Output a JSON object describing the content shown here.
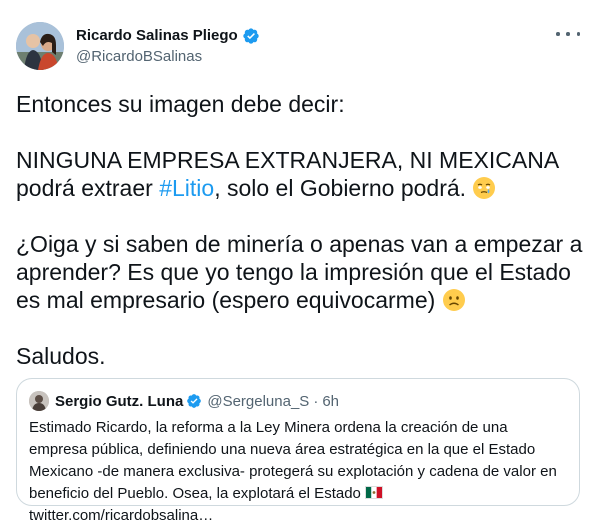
{
  "author": {
    "name": "Ricardo Salinas Pliego",
    "handle": "@RicardoBSalinas"
  },
  "tweet": {
    "p1": "Entonces su imagen debe decir:",
    "p2_part1": "NINGUNA EMPRESA EXTRANJERA, NI MEXICANA podrá extraer ",
    "hashtag": "#Litio",
    "p2_part2": ", solo el Gobierno podrá. ",
    "p3": "¿Oiga y si saben de minería o apenas van a empezar a aprender? Es que yo tengo la impresión que el Estado es mal empresario (espero equivocarme) ",
    "p4": "Saludos."
  },
  "quote": {
    "name": "Sergio Gutz. Luna",
    "handle": "@Sergeluna_S",
    "separator": "·",
    "time": "6h",
    "text_part1": "Estimado Ricardo, la reforma a la Ley Minera ordena la creación de una empresa pública, definiendo una nueva área estratégica en la que el Estado Mexicano -de manera exclusiva- protegerá su explotación y cadena de valor en beneficio del Pueblo. Osea, la explotará el Estado ",
    "link": "twitter.com/ricardobsalina…"
  },
  "icons": {
    "verified": "verified-badge-icon",
    "more": "more-options-icon",
    "emoji_1": "face-holding-back-tears-icon",
    "emoji_2": "slightly-frowning-face-icon",
    "flag": "mexico-flag-icon"
  },
  "colors": {
    "accent": "#1d9bf0",
    "text": "#0f1419",
    "secondary": "#536471",
    "border": "#cfd9de"
  }
}
